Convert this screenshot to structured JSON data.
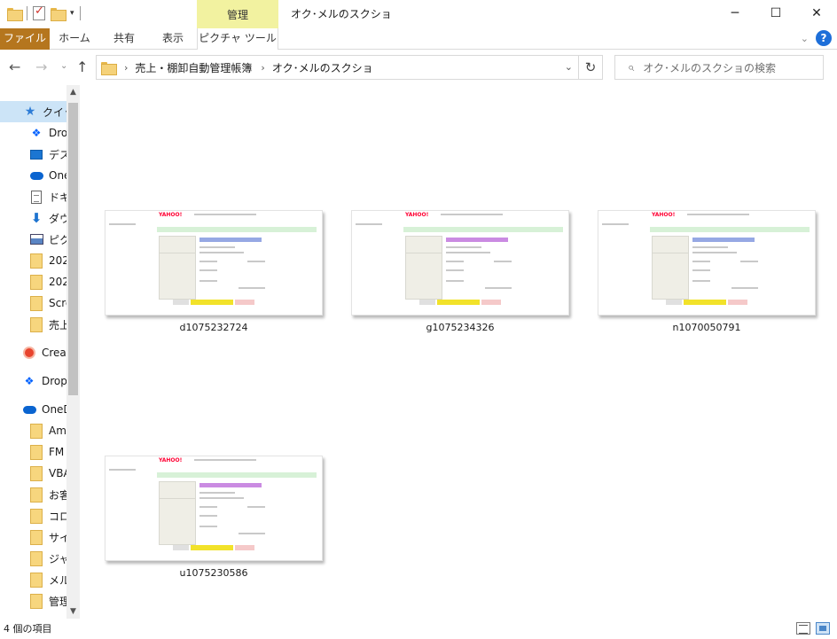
{
  "window": {
    "title": "オク･メルのスクショ",
    "context_tab_group": "管理",
    "controls": {
      "minimize": "─",
      "maximize": "☐",
      "close": "✕"
    }
  },
  "ribbon": {
    "tabs": [
      {
        "label": "ファイル",
        "active": false,
        "color": "#b5761e"
      },
      {
        "label": "ホーム"
      },
      {
        "label": "共有"
      },
      {
        "label": "表示"
      },
      {
        "label": "ピクチャ ツール"
      }
    ],
    "expand_glyph": "⌄",
    "help_glyph": "?"
  },
  "address": {
    "back": "←",
    "forward": "→",
    "recent": "⌄",
    "up": "↑",
    "breadcrumb": [
      "売上・棚卸自動管理帳簿",
      "オク･メルのスクショ"
    ],
    "separator": "›",
    "dropdown": "⌄",
    "refresh": "↻"
  },
  "search": {
    "placeholder": "オク･メルのスクショの検索",
    "icon": "⌕"
  },
  "sidebar": {
    "items": [
      {
        "label": "クイック アクセス",
        "icon": "star-icon",
        "selected": true
      },
      {
        "label": "Dropbox",
        "icon": "dropbox-icon",
        "pinned": true
      },
      {
        "label": "デスクトップ",
        "icon": "desktop-icon",
        "pinned": true
      },
      {
        "label": "OneDrive",
        "icon": "cloud-icon",
        "pinned": true
      },
      {
        "label": "ドキュメント",
        "icon": "document-icon",
        "pinned": true
      },
      {
        "label": "ダウンロード",
        "icon": "download-icon",
        "pinned": true
      },
      {
        "label": "ピクチャ",
        "icon": "picture-icon",
        "pinned": true
      },
      {
        "label": "202",
        "icon": "folder-icon"
      },
      {
        "label": "202",
        "icon": "folder-icon"
      },
      {
        "label": "Scre",
        "icon": "folder-icon"
      },
      {
        "label": "売上",
        "icon": "folder-icon"
      },
      {
        "label": "Creat",
        "icon": "creative-cloud-icon"
      },
      {
        "label": "Drop",
        "icon": "dropbox-icon"
      },
      {
        "label": "OneD",
        "icon": "onedrive-icon"
      },
      {
        "label": "Am",
        "icon": "folder-icon"
      },
      {
        "label": "FM",
        "icon": "folder-icon"
      },
      {
        "label": "VBA",
        "icon": "folder-icon"
      },
      {
        "label": "お客",
        "icon": "folder-icon"
      },
      {
        "label": "コロ",
        "icon": "folder-icon"
      },
      {
        "label": "サイ",
        "icon": "folder-icon"
      },
      {
        "label": "ジャ",
        "icon": "folder-icon"
      },
      {
        "label": "メル",
        "icon": "folder-icon"
      },
      {
        "label": "管理",
        "icon": "folder-icon"
      }
    ]
  },
  "files": [
    {
      "name": "d1075232724"
    },
    {
      "name": "g1075234326"
    },
    {
      "name": "n1070050791"
    },
    {
      "name": "u1075230586"
    }
  ],
  "thumbnail_text": {
    "logo": "YAHOO!"
  },
  "statusbar": {
    "item_count": "4 個の項目"
  }
}
